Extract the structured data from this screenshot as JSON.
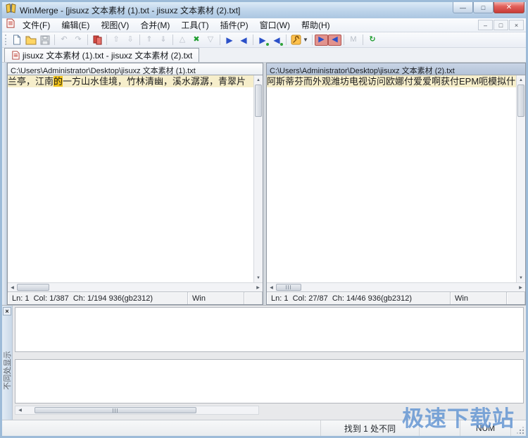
{
  "window": {
    "title": "WinMerge - [jisuxz 文本素材 (1).txt - jisuxz 文本素材 (2).txt]"
  },
  "titlebar_icons": {
    "app": "winmerge-logo",
    "minimize": "—",
    "maximize": "□",
    "close": "✕"
  },
  "menu": {
    "items": [
      "文件(F)",
      "编辑(E)",
      "视图(V)",
      "合并(M)",
      "工具(T)",
      "插件(P)",
      "窗口(W)",
      "帮助(H)"
    ],
    "mdi": {
      "minimize": "–",
      "restore": "□",
      "close": "×"
    }
  },
  "toolbar": {
    "dropdown_caret": "▼",
    "buttons": [
      {
        "name": "new-file",
        "glyph": ""
      },
      {
        "name": "open-file",
        "glyph": ""
      },
      {
        "name": "save",
        "glyph": ""
      },
      {
        "name": "undo",
        "glyph": "↶"
      },
      {
        "name": "redo",
        "glyph": "↷"
      },
      {
        "name": "rescan",
        "glyph": ""
      },
      {
        "name": "goto-prev-diff",
        "glyph": "⇧"
      },
      {
        "name": "goto-next-diff",
        "glyph": "⇩"
      },
      {
        "name": "goto-prev-conflict",
        "glyph": "⇑"
      },
      {
        "name": "goto-next-conflict",
        "glyph": "⇓"
      },
      {
        "name": "first-diff",
        "glyph": "△"
      },
      {
        "name": "current-diff",
        "glyph": "✖"
      },
      {
        "name": "last-diff",
        "glyph": "▽"
      },
      {
        "name": "copy-right",
        "glyph": "▶"
      },
      {
        "name": "copy-left",
        "glyph": "◀"
      },
      {
        "name": "copy-right-advance",
        "glyph": "▶"
      },
      {
        "name": "copy-left-advance",
        "glyph": "◀"
      },
      {
        "name": "options",
        "glyph": ""
      },
      {
        "name": "copy-all-right",
        "glyph": "▶"
      },
      {
        "name": "copy-all-left",
        "glyph": "◀"
      },
      {
        "name": "merge-mode",
        "glyph": "M"
      },
      {
        "name": "refresh",
        "glyph": "↻"
      }
    ]
  },
  "tabs": [
    {
      "label": "jisuxz 文本素材 (1).txt - jisuxz 文本素材 (2).txt"
    }
  ],
  "left_pane": {
    "path": "C:\\Users\\Administrator\\Desktop\\jisuxz 文本素材 (1).txt",
    "line_prefix": "兰亭，江南",
    "line_highlight": "的",
    "line_suffix": "一方山水佳境，竹林清幽，溪水潺潺，青翠片",
    "status_position": "Ln: 1  Col: 1/387  Ch: 1/194 936(gb2312)",
    "status_eol": "Win"
  },
  "right_pane": {
    "path": "C:\\Users\\Administrator\\Desktop\\jisuxz 文本素材 (2).txt",
    "line": "阿斯蒂芬而外观潍坊电视访问欧娜付爱爱啊获付EPM呃模拟什",
    "status_position": "Ln: 1  Col: 27/87  Ch: 14/46 936(gb2312)",
    "status_eol": "Win"
  },
  "diff_pane": {
    "close_glyph": "×",
    "vertical_label": "不同处显示"
  },
  "statusbar": {
    "diff_result": "找到 1 处不同",
    "num_lock": "NUM"
  },
  "watermark": {
    "text": "极速下载站",
    "color": "#5e92d2"
  },
  "scroll_glyphs": {
    "up": "▲",
    "down": "▼",
    "left": "◀",
    "right": "▶"
  },
  "colors": {
    "diff_line_bg": "#f6eecb",
    "diff_word_bg": "#efc118",
    "selected_header_bg": "#bcc9dd",
    "titlebar_bg": "#c2d7ec",
    "close_button": "#c83c37"
  }
}
